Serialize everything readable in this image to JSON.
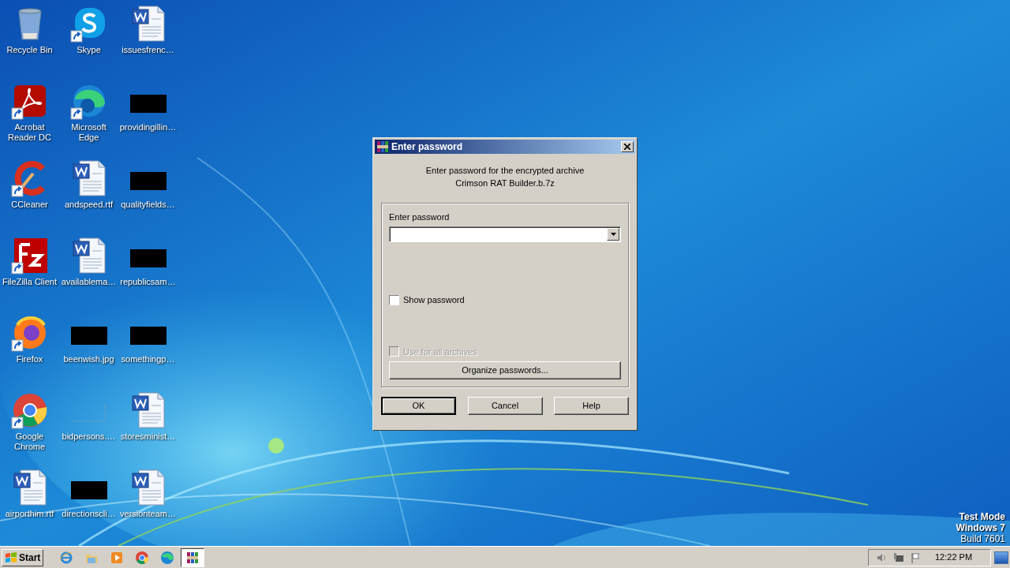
{
  "desktop": {
    "icons": [
      {
        "label": "Recycle Bin",
        "kind": "recycle",
        "shortcut": false
      },
      {
        "label": "Acrobat Reader DC",
        "kind": "acrobat",
        "shortcut": true
      },
      {
        "label": "CCleaner",
        "kind": "ccleaner",
        "shortcut": true
      },
      {
        "label": "FileZilla Client",
        "kind": "filezilla",
        "shortcut": true
      },
      {
        "label": "Firefox",
        "kind": "firefox",
        "shortcut": true
      },
      {
        "label": "Google Chrome",
        "kind": "chrome",
        "shortcut": true
      },
      {
        "label": "airporthim.rtf",
        "kind": "word",
        "shortcut": false
      },
      {
        "label": "Skype",
        "kind": "skype",
        "shortcut": true
      },
      {
        "label": "Microsoft Edge",
        "kind": "edge",
        "shortcut": true
      },
      {
        "label": "andspeed.rtf",
        "kind": "word",
        "shortcut": false
      },
      {
        "label": "availablema…",
        "kind": "word",
        "shortcut": false
      },
      {
        "label": "beenwish.jpg",
        "kind": "redacted",
        "shortcut": false
      },
      {
        "label": "bidpersons.…",
        "kind": "blank",
        "shortcut": false
      },
      {
        "label": "directionscli…",
        "kind": "redacted",
        "shortcut": false
      },
      {
        "label": "issuesfrenc…",
        "kind": "word",
        "shortcut": false
      },
      {
        "label": "providingillin…",
        "kind": "redacted",
        "shortcut": false
      },
      {
        "label": "qualityfields…",
        "kind": "redacted",
        "shortcut": false
      },
      {
        "label": "republicsam…",
        "kind": "redacted",
        "shortcut": false
      },
      {
        "label": "somethingp…",
        "kind": "redacted",
        "shortcut": false
      },
      {
        "label": "storesminist…",
        "kind": "word",
        "shortcut": false
      },
      {
        "label": "versionteam…",
        "kind": "word",
        "shortcut": false
      }
    ],
    "os_notice": [
      "Test Mode",
      "Windows 7",
      "Build 7601"
    ]
  },
  "dialog": {
    "title": "Enter password",
    "message": [
      "Enter password for the encrypted archive",
      "Crimson RAT Builder.b.7z"
    ],
    "password": {
      "label": "Enter password"
    },
    "checkboxes": [
      {
        "label": "Show password",
        "checked": false,
        "disabled": false
      },
      {
        "label": "Use for all archives",
        "checked": false,
        "disabled": true
      }
    ],
    "organize_button": "Organize passwords...",
    "buttons": [
      {
        "label": "OK",
        "default": true
      },
      {
        "label": "Cancel",
        "default": false
      },
      {
        "label": "Help",
        "default": false
      }
    ]
  },
  "taskbar": {
    "start": "Start",
    "items": [
      {
        "kind": "ie",
        "selected": false
      },
      {
        "kind": "explorer",
        "selected": false
      },
      {
        "kind": "media",
        "selected": false
      },
      {
        "kind": "chrome",
        "selected": false
      },
      {
        "kind": "edge",
        "selected": false
      },
      {
        "kind": "winrar",
        "selected": true
      }
    ],
    "clock": "12:22 PM"
  }
}
